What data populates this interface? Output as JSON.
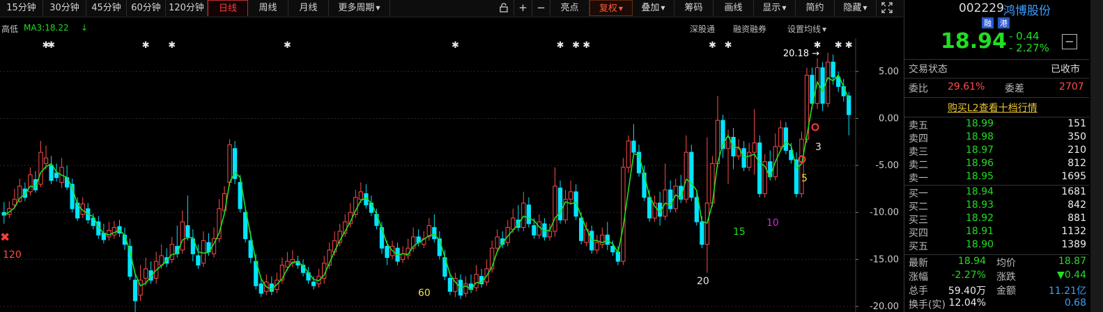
{
  "toolbar": {
    "periods": [
      "15分钟",
      "30分钟",
      "45分钟",
      "60分钟",
      "120分钟",
      "日线",
      "周线",
      "月线",
      "更多周期"
    ],
    "active_period": "日线",
    "icons": [
      "lock-icon",
      "plus-icon",
      "minus-icon"
    ],
    "right_buttons": [
      "亮点",
      "复权",
      "叠加",
      "筹码",
      "画线",
      "显示",
      "简约",
      "隐藏"
    ],
    "expand_icon": "expand-icon"
  },
  "subbar": {
    "left_label": "高低",
    "ma_label": "MA3:18.22",
    "ma_arrow": "↓",
    "right_items": [
      "深股通",
      "融资融券",
      "设置均线"
    ]
  },
  "chart_data": {
    "type": "candlestick",
    "ma_line": "MA3",
    "ma_color": "#22dd22",
    "up_color": "#ff4d4d",
    "down_color": "#00e5ff",
    "y_ticks": [
      "5.00",
      "0.00",
      "-5.00",
      "-10.00",
      "-15.00",
      "-20.00"
    ],
    "ylim": [
      -20,
      7.5
    ],
    "annotations": {
      "high_label": "20.18",
      "cycle_labels": [
        "120",
        "60",
        "20",
        "15",
        "10",
        "5",
        "3"
      ]
    },
    "candles": [
      {
        "o": -10,
        "c": -10.3,
        "h": -8.9,
        "l": -11.2
      },
      {
        "o": -10.2,
        "c": -9.6,
        "h": -8.8,
        "l": -10.6
      },
      {
        "o": -9.2,
        "c": -8.6,
        "h": -7.5,
        "l": -9.6
      },
      {
        "o": -8.8,
        "c": -7.2,
        "h": -6.4,
        "l": -9.0
      },
      {
        "o": -7.5,
        "c": -8.4,
        "h": -6.8,
        "l": -8.8
      },
      {
        "o": -7.8,
        "c": -6.0,
        "h": -5.2,
        "l": -8.2
      },
      {
        "o": -6.5,
        "c": -7.6,
        "h": -5.6,
        "l": -7.9
      },
      {
        "o": -7.0,
        "c": -3.6,
        "h": -2.4,
        "l": -7.3
      },
      {
        "o": -4.8,
        "c": -4.2,
        "h": -2.9,
        "l": -5.4
      },
      {
        "o": -5.0,
        "c": -6.6,
        "h": -4.0,
        "l": -7.0
      },
      {
        "o": -5.8,
        "c": -6.3,
        "h": -4.8,
        "l": -6.7
      },
      {
        "o": -6.8,
        "c": -5.2,
        "h": -4.2,
        "l": -7.4
      },
      {
        "o": -6.3,
        "c": -7.3,
        "h": -5.0,
        "l": -7.6
      },
      {
        "o": -7.0,
        "c": -9.6,
        "h": -6.4,
        "l": -10.0
      },
      {
        "o": -9.0,
        "c": -10.6,
        "h": -8.4,
        "l": -10.9
      },
      {
        "o": -10.2,
        "c": -9.1,
        "h": -8.4,
        "l": -10.6
      },
      {
        "o": -9.6,
        "c": -10.8,
        "h": -9.0,
        "l": -11.2
      },
      {
        "o": -10.6,
        "c": -11.4,
        "h": -10.1,
        "l": -11.8
      },
      {
        "o": -11.0,
        "c": -12.4,
        "h": -10.4,
        "l": -12.8
      },
      {
        "o": -12.2,
        "c": -12.9,
        "h": -11.2,
        "l": -13.3
      },
      {
        "o": -12.6,
        "c": -11.9,
        "h": -11.0,
        "l": -13.0
      },
      {
        "o": -12.4,
        "c": -11.6,
        "h": -10.9,
        "l": -12.8
      },
      {
        "o": -11.5,
        "c": -12.2,
        "h": -10.8,
        "l": -12.6
      },
      {
        "o": -12.4,
        "c": -13.4,
        "h": -11.6,
        "l": -14.0
      },
      {
        "o": -13.6,
        "c": -16.8,
        "h": -12.8,
        "l": -17.2
      },
      {
        "o": -17.2,
        "c": -19.4,
        "h": -16.4,
        "l": -20.6
      },
      {
        "o": -18.8,
        "c": -17.2,
        "h": -15.6,
        "l": -19.4
      },
      {
        "o": -17.0,
        "c": -16.0,
        "h": -14.8,
        "l": -17.8
      },
      {
        "o": -16.2,
        "c": -17.2,
        "h": -15.2,
        "l": -17.6
      },
      {
        "o": -17.0,
        "c": -15.2,
        "h": -14.2,
        "l": -17.6
      },
      {
        "o": -15.6,
        "c": -14.6,
        "h": -13.4,
        "l": -16.0
      },
      {
        "o": -14.8,
        "c": -15.4,
        "h": -13.8,
        "l": -15.8
      },
      {
        "o": -15.0,
        "c": -13.4,
        "h": -12.6,
        "l": -15.4
      },
      {
        "o": -13.6,
        "c": -14.4,
        "h": -11.4,
        "l": -14.8
      },
      {
        "o": -14.0,
        "c": -11.0,
        "h": -9.8,
        "l": -14.4
      },
      {
        "o": -11.4,
        "c": -12.6,
        "h": -8.2,
        "l": -13.0
      },
      {
        "o": -12.8,
        "c": -14.4,
        "h": -11.8,
        "l": -15.2
      },
      {
        "o": -14.6,
        "c": -15.6,
        "h": -13.4,
        "l": -16.0
      },
      {
        "o": -15.4,
        "c": -13.0,
        "h": -12.0,
        "l": -15.8
      },
      {
        "o": -13.2,
        "c": -14.2,
        "h": -12.2,
        "l": -14.6
      },
      {
        "o": -14.4,
        "c": -12.8,
        "h": -11.6,
        "l": -14.8
      },
      {
        "o": -12.8,
        "c": -9.6,
        "h": -8.6,
        "l": -13.2
      },
      {
        "o": -9.8,
        "c": -8.0,
        "h": -7.2,
        "l": -10.2
      },
      {
        "o": -6.8,
        "c": -2.8,
        "h": -2.2,
        "l": -7.2
      },
      {
        "o": -3.2,
        "c": -6.4,
        "h": -2.4,
        "l": -7.0
      },
      {
        "o": -6.8,
        "c": -9.6,
        "h": -6.0,
        "l": -10.0
      },
      {
        "o": -10.0,
        "c": -12.8,
        "h": -9.4,
        "l": -13.2
      },
      {
        "o": -13.0,
        "c": -14.8,
        "h": -12.0,
        "l": -15.4
      },
      {
        "o": -15.2,
        "c": -17.8,
        "h": -14.4,
        "l": -18.2
      },
      {
        "o": -17.6,
        "c": -18.6,
        "h": -17.0,
        "l": -19.0
      },
      {
        "o": -18.4,
        "c": -17.4,
        "h": -16.6,
        "l": -18.8
      },
      {
        "o": -17.6,
        "c": -18.4,
        "h": -16.8,
        "l": -18.8
      },
      {
        "o": -18.2,
        "c": -17.2,
        "h": -16.4,
        "l": -18.6
      },
      {
        "o": -17.2,
        "c": -15.6,
        "h": -14.8,
        "l": -17.6
      },
      {
        "o": -15.8,
        "c": -15.2,
        "h": -14.2,
        "l": -16.2
      },
      {
        "o": -15.4,
        "c": -15.0,
        "h": -14.0,
        "l": -15.8
      },
      {
        "o": -15.2,
        "c": -15.6,
        "h": -14.6,
        "l": -16.0
      },
      {
        "o": -15.6,
        "c": -16.4,
        "h": -15.0,
        "l": -16.8
      },
      {
        "o": -16.4,
        "c": -17.2,
        "h": -15.8,
        "l": -17.6
      },
      {
        "o": -17.4,
        "c": -17.8,
        "h": -16.8,
        "l": -18.2
      },
      {
        "o": -17.6,
        "c": -16.8,
        "h": -16.0,
        "l": -18.0
      },
      {
        "o": -17.0,
        "c": -15.4,
        "h": -14.6,
        "l": -17.6
      },
      {
        "o": -15.6,
        "c": -14.0,
        "h": -13.2,
        "l": -16.0
      },
      {
        "o": -14.2,
        "c": -13.0,
        "h": -12.0,
        "l": -14.6
      },
      {
        "o": -13.2,
        "c": -12.0,
        "h": -11.2,
        "l": -13.6
      },
      {
        "o": -12.2,
        "c": -11.0,
        "h": -10.2,
        "l": -12.6
      },
      {
        "o": -11.2,
        "c": -10.0,
        "h": -9.0,
        "l": -11.6
      },
      {
        "o": -10.2,
        "c": -8.4,
        "h": -7.6,
        "l": -10.6
      },
      {
        "o": -8.6,
        "c": -7.8,
        "h": -6.8,
        "l": -9.0
      },
      {
        "o": -8.0,
        "c": -9.2,
        "h": -7.0,
        "l": -9.6
      },
      {
        "o": -9.0,
        "c": -10.0,
        "h": -8.2,
        "l": -10.4
      },
      {
        "o": -10.2,
        "c": -11.4,
        "h": -9.6,
        "l": -11.8
      },
      {
        "o": -11.6,
        "c": -13.8,
        "h": -11.0,
        "l": -14.4
      },
      {
        "o": -13.6,
        "c": -14.8,
        "h": -13.0,
        "l": -15.6
      },
      {
        "o": -14.6,
        "c": -13.6,
        "h": -13.0,
        "l": -15.0
      },
      {
        "o": -13.8,
        "c": -15.2,
        "h": -13.2,
        "l": -15.6
      },
      {
        "o": -15.0,
        "c": -14.4,
        "h": -13.6,
        "l": -15.4
      },
      {
        "o": -14.6,
        "c": -13.8,
        "h": -12.8,
        "l": -15.0
      },
      {
        "o": -13.8,
        "c": -12.6,
        "h": -11.6,
        "l": -14.2
      },
      {
        "o": -12.6,
        "c": -13.2,
        "h": -11.8,
        "l": -13.6
      },
      {
        "o": -13.4,
        "c": -12.8,
        "h": -12.0,
        "l": -13.8
      },
      {
        "o": -12.6,
        "c": -11.4,
        "h": -10.6,
        "l": -13.0
      },
      {
        "o": -11.6,
        "c": -12.8,
        "h": -10.2,
        "l": -13.2
      },
      {
        "o": -12.8,
        "c": -14.6,
        "h": -12.0,
        "l": -15.0
      },
      {
        "o": -14.8,
        "c": -16.8,
        "h": -14.0,
        "l": -17.2
      },
      {
        "o": -17.0,
        "c": -18.4,
        "h": -16.4,
        "l": -18.8
      },
      {
        "o": -18.4,
        "c": -17.0,
        "h": -16.4,
        "l": -19.0
      },
      {
        "o": -17.2,
        "c": -18.8,
        "h": -16.6,
        "l": -19.2
      },
      {
        "o": -18.6,
        "c": -17.6,
        "h": -16.8,
        "l": -19.0
      },
      {
        "o": -17.6,
        "c": -18.2,
        "h": -16.6,
        "l": -18.6
      },
      {
        "o": -18.0,
        "c": -16.6,
        "h": -15.6,
        "l": -18.4
      },
      {
        "o": -16.8,
        "c": -17.6,
        "h": -16.0,
        "l": -18.0
      },
      {
        "o": -17.4,
        "c": -16.0,
        "h": -15.0,
        "l": -17.8
      },
      {
        "o": -16.0,
        "c": -13.8,
        "h": -13.0,
        "l": -16.4
      },
      {
        "o": -13.8,
        "c": -12.6,
        "h": -11.8,
        "l": -14.2
      },
      {
        "o": -12.8,
        "c": -13.4,
        "h": -12.0,
        "l": -13.8
      },
      {
        "o": -13.2,
        "c": -11.6,
        "h": -10.8,
        "l": -13.6
      },
      {
        "o": -11.8,
        "c": -10.6,
        "h": -9.6,
        "l": -12.2
      },
      {
        "o": -10.8,
        "c": -11.6,
        "h": -9.2,
        "l": -12.0
      },
      {
        "o": -11.6,
        "c": -9.0,
        "h": -7.8,
        "l": -12.0
      },
      {
        "o": -9.2,
        "c": -11.2,
        "h": -8.4,
        "l": -11.6
      },
      {
        "o": -11.4,
        "c": -12.4,
        "h": -10.6,
        "l": -12.8
      },
      {
        "o": -12.4,
        "c": -11.0,
        "h": -10.2,
        "l": -12.8
      },
      {
        "o": -11.2,
        "c": -12.6,
        "h": -10.6,
        "l": -13.0
      },
      {
        "o": -12.6,
        "c": -12.0,
        "h": -11.2,
        "l": -13.0
      },
      {
        "o": -12.0,
        "c": -7.2,
        "h": -5.2,
        "l": -12.6
      },
      {
        "o": -7.4,
        "c": -10.8,
        "h": -6.6,
        "l": -11.2
      },
      {
        "o": -10.8,
        "c": -8.6,
        "h": -7.6,
        "l": -11.2
      },
      {
        "o": -8.6,
        "c": -7.8,
        "h": -6.6,
        "l": -9.2
      },
      {
        "o": -7.8,
        "c": -10.4,
        "h": -7.0,
        "l": -10.8
      },
      {
        "o": -10.6,
        "c": -13.0,
        "h": -10.0,
        "l": -13.4
      },
      {
        "o": -13.2,
        "c": -11.8,
        "h": -11.0,
        "l": -13.6
      },
      {
        "o": -12.0,
        "c": -14.0,
        "h": -11.4,
        "l": -14.4
      },
      {
        "o": -14.0,
        "c": -13.2,
        "h": -12.4,
        "l": -14.4
      },
      {
        "o": -13.4,
        "c": -12.4,
        "h": -11.6,
        "l": -13.8
      },
      {
        "o": -12.4,
        "c": -13.4,
        "h": -11.0,
        "l": -14.0
      },
      {
        "o": -13.6,
        "c": -14.2,
        "h": -13.0,
        "l": -14.6
      },
      {
        "o": -14.2,
        "c": -15.2,
        "h": -13.6,
        "l": -15.6
      },
      {
        "o": -15.2,
        "c": -5.2,
        "h": -4.2,
        "l": -15.6
      },
      {
        "o": -5.2,
        "c": -2.4,
        "h": -1.8,
        "l": -5.8
      },
      {
        "o": -2.4,
        "c": -3.6,
        "h": -0.6,
        "l": -4.0
      },
      {
        "o": -3.6,
        "c": -5.8,
        "h": -2.8,
        "l": -6.2
      },
      {
        "o": -5.8,
        "c": -8.4,
        "h": -5.0,
        "l": -8.8
      },
      {
        "o": -8.4,
        "c": -10.6,
        "h": -7.6,
        "l": -11.0
      },
      {
        "o": -10.6,
        "c": -9.0,
        "h": -8.2,
        "l": -11.0
      },
      {
        "o": -9.0,
        "c": -10.4,
        "h": -7.8,
        "l": -11.4
      },
      {
        "o": -10.4,
        "c": -7.6,
        "h": -4.8,
        "l": -10.8
      },
      {
        "o": -7.6,
        "c": -9.6,
        "h": -6.6,
        "l": -10.0
      },
      {
        "o": -9.6,
        "c": -7.2,
        "h": -6.4,
        "l": -10.0
      },
      {
        "o": -7.2,
        "c": -8.6,
        "h": -6.0,
        "l": -9.0
      },
      {
        "o": -8.6,
        "c": -3.6,
        "h": -1.8,
        "l": -9.0
      },
      {
        "o": -3.6,
        "c": -8.4,
        "h": -2.8,
        "l": -8.8
      },
      {
        "o": -8.4,
        "c": -11.0,
        "h": -7.6,
        "l": -11.4
      },
      {
        "o": -11.0,
        "c": -13.4,
        "h": -10.4,
        "l": -13.8
      },
      {
        "o": -13.4,
        "c": -9.0,
        "h": -2.0,
        "l": -16.4
      },
      {
        "o": -9.0,
        "c": -4.8,
        "h": -4.0,
        "l": -9.4
      },
      {
        "o": -4.8,
        "c": -0.2,
        "h": 2.4,
        "l": -5.2
      },
      {
        "o": -0.2,
        "c": -3.2,
        "h": 0.4,
        "l": -4.2
      },
      {
        "o": -3.2,
        "c": -2.0,
        "h": -1.2,
        "l": -7.0
      },
      {
        "o": -2.0,
        "c": -4.0,
        "h": -1.0,
        "l": -5.4
      },
      {
        "o": -4.0,
        "c": -3.2,
        "h": -2.2,
        "l": -4.4
      },
      {
        "o": -3.2,
        "c": -5.2,
        "h": -2.4,
        "l": -5.6
      },
      {
        "o": -5.2,
        "c": -3.6,
        "h": -2.6,
        "l": -5.6
      },
      {
        "o": -3.6,
        "c": -2.6,
        "h": 1.0,
        "l": -6.0
      },
      {
        "o": -2.6,
        "c": -8.0,
        "h": -1.8,
        "l": -8.4
      },
      {
        "o": -8.0,
        "c": -4.6,
        "h": -3.8,
        "l": -8.4
      },
      {
        "o": -4.6,
        "c": -6.2,
        "h": -3.4,
        "l": -6.6
      },
      {
        "o": -6.2,
        "c": -3.0,
        "h": -1.6,
        "l": -6.6
      },
      {
        "o": -3.0,
        "c": -1.0,
        "h": -0.2,
        "l": -3.4
      },
      {
        "o": -1.0,
        "c": -3.4,
        "h": -0.4,
        "l": -3.8
      },
      {
        "o": -3.4,
        "c": -4.4,
        "h": -2.6,
        "l": -4.8
      },
      {
        "o": -4.4,
        "c": -8.0,
        "h": -3.6,
        "l": -8.4
      },
      {
        "o": -8.0,
        "c": -2.2,
        "h": -1.4,
        "l": -8.4
      },
      {
        "o": -2.2,
        "c": 4.6,
        "h": 5.4,
        "l": -2.6
      },
      {
        "o": 4.6,
        "c": 1.6,
        "h": 5.4,
        "l": 1.0
      },
      {
        "o": 1.6,
        "c": 5.4,
        "h": 6.4,
        "l": 1.0
      },
      {
        "o": 5.4,
        "c": 1.6,
        "h": 6.0,
        "l": 0.8
      },
      {
        "o": 1.6,
        "c": 6.0,
        "h": 7.0,
        "l": 1.2
      },
      {
        "o": 6.0,
        "c": 4.4,
        "h": 6.8,
        "l": 3.6
      },
      {
        "o": 4.4,
        "c": 3.4,
        "h": 5.0,
        "l": 2.8
      },
      {
        "o": 3.4,
        "c": 2.4,
        "h": 4.2,
        "l": 1.8
      },
      {
        "o": 2.4,
        "c": 0.4,
        "h": 2.8,
        "l": -1.8
      }
    ]
  },
  "panel": {
    "code": "002229",
    "name": "鸿博股份",
    "tag_margin": "融",
    "tag_hk": "港",
    "price": "18.94",
    "change": "- 0.44",
    "change_pct": "- 2.27%",
    "status_label": "交易状态",
    "status_value": "已收市",
    "ratio_label": "委比",
    "ratio_value": "29.61%",
    "diff_label": "委差",
    "diff_value": "2707",
    "l2_link": "购买L2查看十档行情",
    "sell": [
      {
        "label": "卖五",
        "price": "18.99",
        "vol": "151"
      },
      {
        "label": "卖四",
        "price": "18.98",
        "vol": "350"
      },
      {
        "label": "卖三",
        "price": "18.97",
        "vol": "210"
      },
      {
        "label": "卖二",
        "price": "18.96",
        "vol": "812"
      },
      {
        "label": "卖一",
        "price": "18.95",
        "vol": "1695"
      }
    ],
    "buy": [
      {
        "label": "买一",
        "price": "18.94",
        "vol": "1681"
      },
      {
        "label": "买二",
        "price": "18.93",
        "vol": "842"
      },
      {
        "label": "买三",
        "price": "18.92",
        "vol": "881"
      },
      {
        "label": "买四",
        "price": "18.91",
        "vol": "1132"
      },
      {
        "label": "买五",
        "price": "18.90",
        "vol": "1389"
      }
    ],
    "stats": [
      {
        "l1": "最新",
        "v1": "18.94",
        "l2": "均价",
        "v2": "18.87"
      },
      {
        "l1": "涨幅",
        "v1": "-2.27%",
        "l2": "涨跌",
        "v2": "▼0.44"
      },
      {
        "l1": "总手",
        "v1": "59.40万",
        "l2": "金额",
        "v2": "11.21亿"
      },
      {
        "l1": "换手(实)",
        "v1": "12.04%",
        "l2": "",
        "v2": "0.68"
      }
    ]
  }
}
